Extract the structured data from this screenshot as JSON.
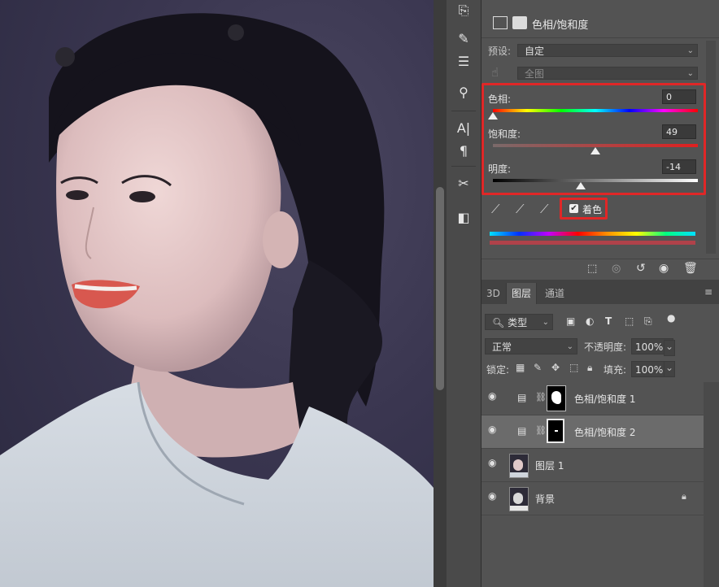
{
  "properties": {
    "title": "色相/饱和度",
    "preset_label": "预设:",
    "preset_value": "自定",
    "channel_value": "全图",
    "hue_label": "色相:",
    "hue_value": "0",
    "saturation_label": "饱和度:",
    "saturation_value": "49",
    "lightness_label": "明度:",
    "lightness_value": "-14",
    "colorize_label": "着色",
    "colorize_checked": true,
    "hue_fraction": 0.0,
    "saturation_fraction": 0.5,
    "lightness_fraction": 0.43
  },
  "layers_panel": {
    "tabs": [
      "3D",
      "图层",
      "通道"
    ],
    "filter_value": "类型",
    "blend_mode": "正常",
    "opacity_label": "不透明度:",
    "opacity_value": "100%",
    "lock_label": "锁定:",
    "fill_label": "填充:",
    "fill_value": "100%",
    "layers": [
      {
        "name": "色相/饱和度 1",
        "type": "adjustment",
        "visible": true,
        "selected": false
      },
      {
        "name": "色相/饱和度 2",
        "type": "adjustment",
        "visible": true,
        "selected": true
      },
      {
        "name": "图层 1",
        "type": "pixel",
        "visible": true,
        "selected": false
      },
      {
        "name": "背景",
        "type": "pixel",
        "visible": true,
        "selected": false,
        "locked": true
      }
    ]
  },
  "colors": {
    "highlight": "#e02727",
    "panel_bg": "#535353",
    "selected_row": "#6b6b6b"
  }
}
